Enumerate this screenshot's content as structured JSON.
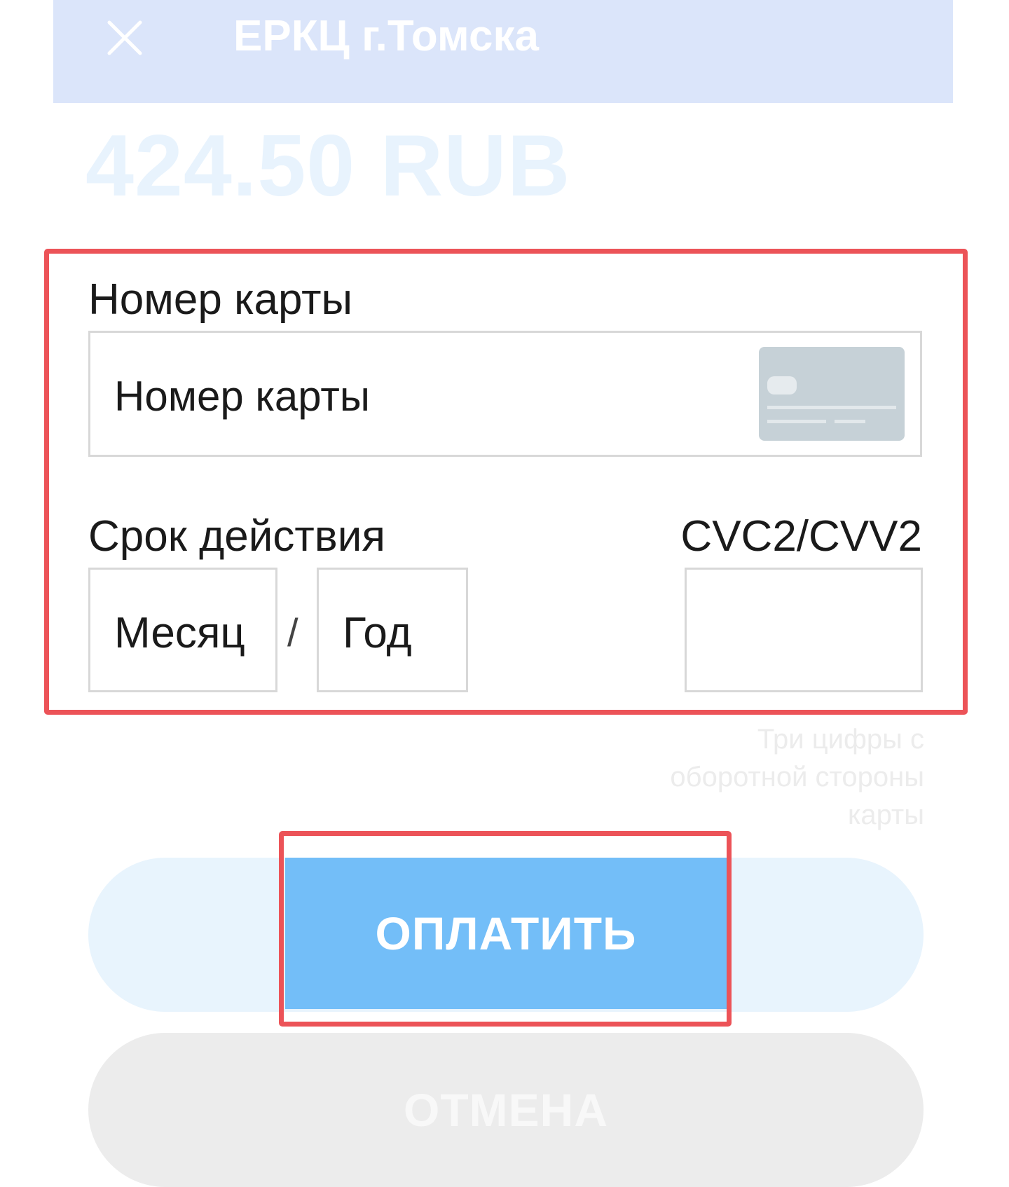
{
  "header": {
    "title": "ЕРКЦ г.Томска",
    "close_icon": "close-icon"
  },
  "payment": {
    "amount": "424.50 RUB"
  },
  "form": {
    "card_number": {
      "label": "Номер карты",
      "placeholder": "Номер карты",
      "icon": "credit-card-icon"
    },
    "expiry": {
      "label": "Срок действия",
      "month_placeholder": "Месяц",
      "separator": "/",
      "year_placeholder": "Год"
    },
    "cvc": {
      "label": "CVC2/CVV2",
      "hint_lines": [
        "Три цифры с",
        "оборотной стороны",
        "карты"
      ]
    }
  },
  "buttons": {
    "pay_label": "ОПЛАТИТЬ",
    "cancel_label": "ОТМЕНА"
  },
  "colors": {
    "highlight": "#ec5358",
    "header_bg": "#dbe5fa",
    "pay_button": "#73bef8",
    "cancel_button": "#ececec",
    "amount_text": "#e8f3fd"
  }
}
